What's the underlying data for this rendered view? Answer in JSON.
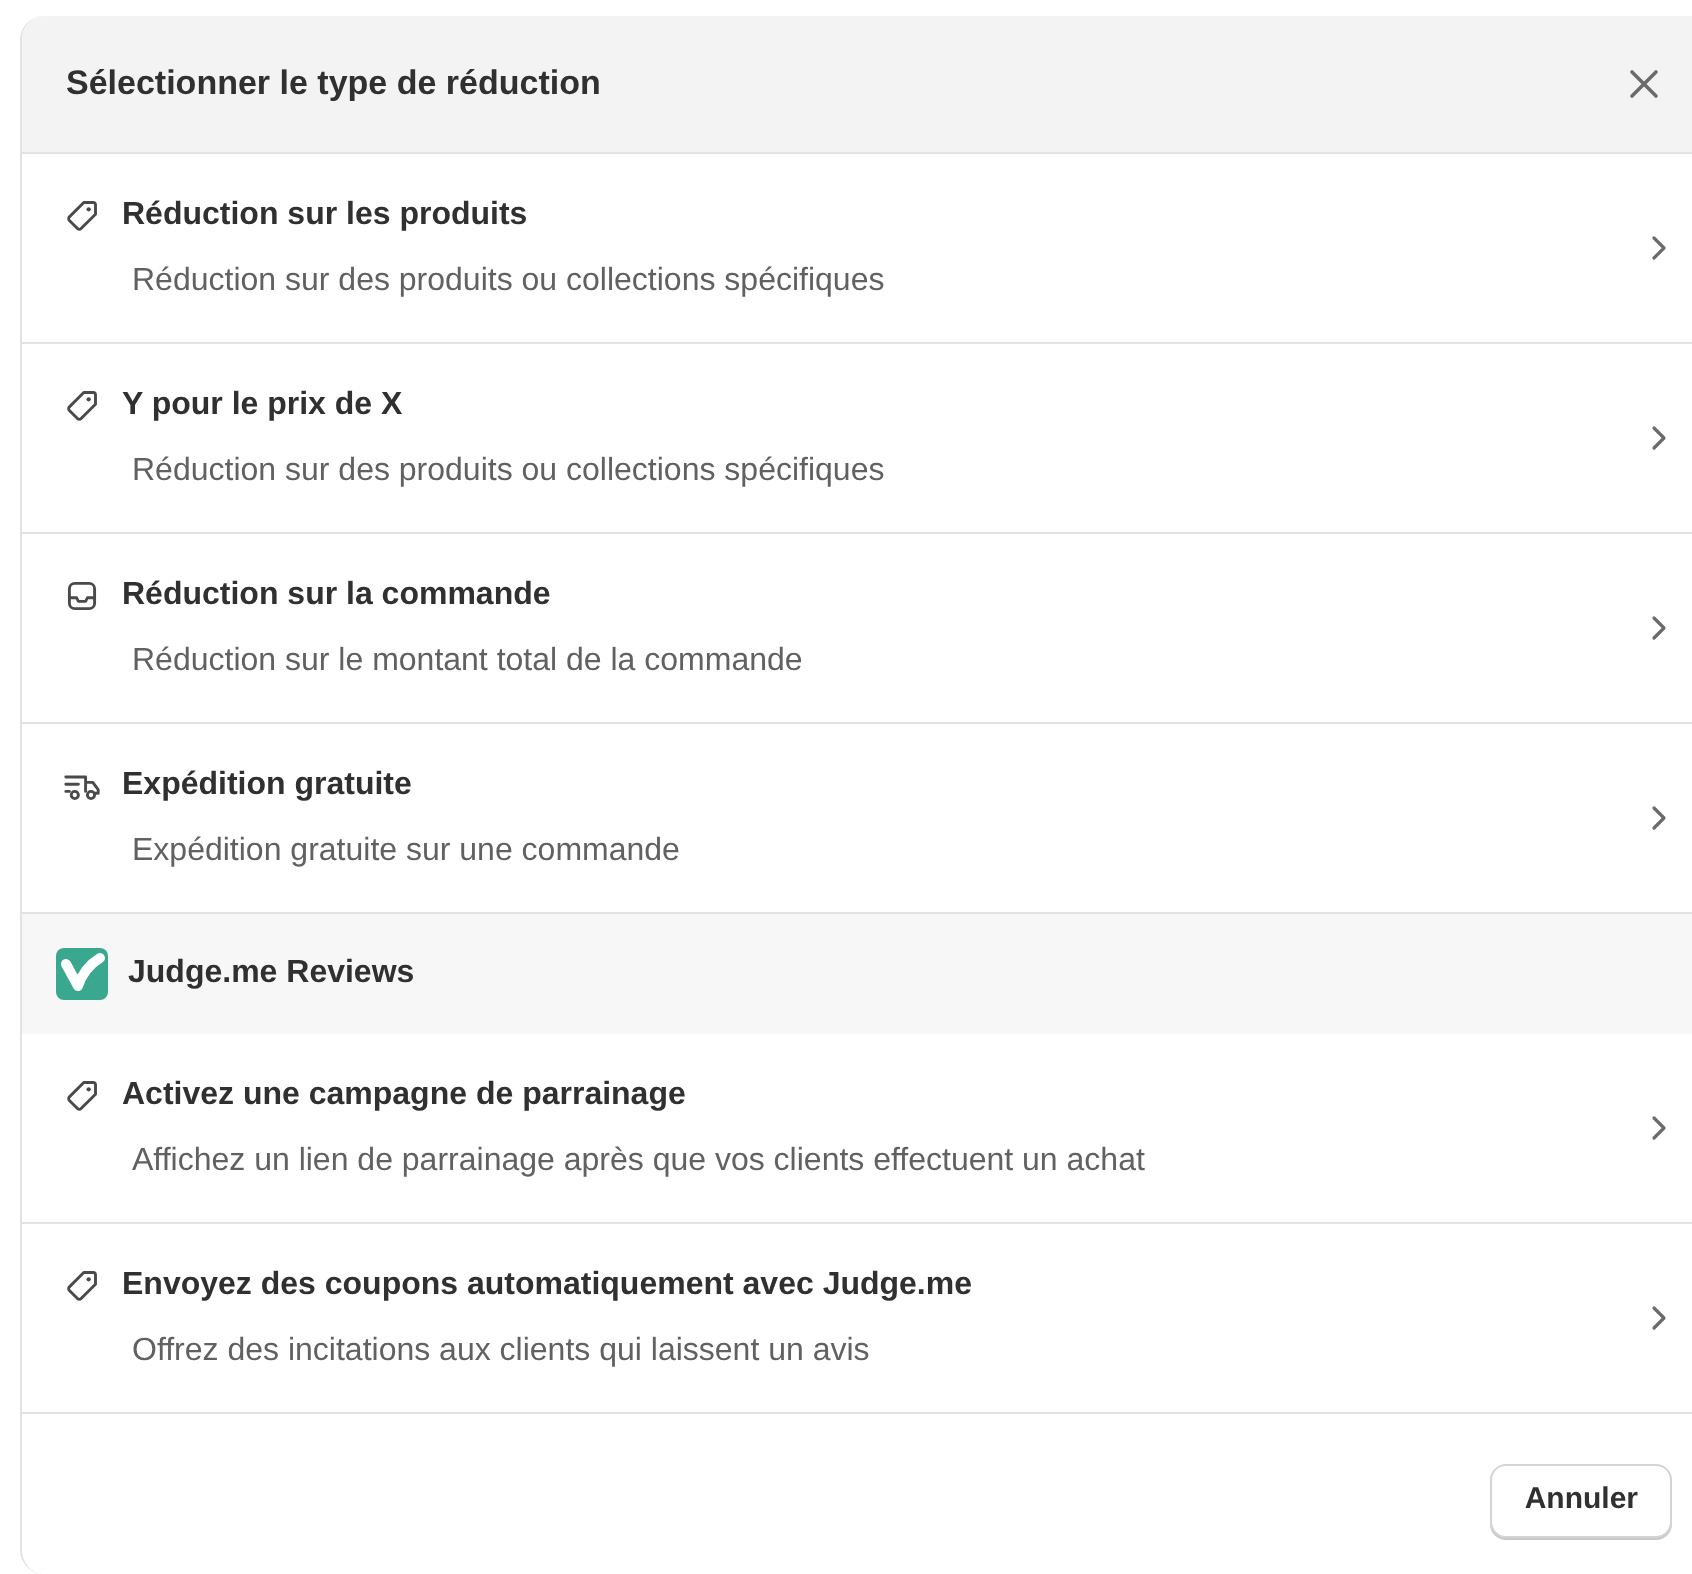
{
  "dialog": {
    "title": "Sélectionner le type de réduction",
    "items": [
      {
        "kind": "option",
        "title": "Réduction sur les produits",
        "description": "Réduction sur des produits ou collections spécifiques"
      },
      {
        "kind": "option",
        "title": "Y pour le prix de X",
        "description": "Réduction sur des produits ou collections spécifiques"
      },
      {
        "kind": "option",
        "title": "Réduction sur la commande",
        "description": "Réduction sur le montant total de la commande"
      },
      {
        "kind": "option",
        "title": "Expédition gratuite",
        "description": "Expédition gratuite sur une commande"
      },
      {
        "kind": "section",
        "title": "Judge.me Reviews"
      },
      {
        "kind": "option",
        "title": "Activez une campagne de parrainage",
        "description": "Affichez un lien de parrainage après que vos clients effectuent un achat"
      },
      {
        "kind": "option",
        "title": "Envoyez des coupons automatiquement avec Judge.me",
        "description": "Offrez des incitations aux clients qui laissent un avis"
      }
    ],
    "buttons": [
      "Annuler"
    ]
  }
}
